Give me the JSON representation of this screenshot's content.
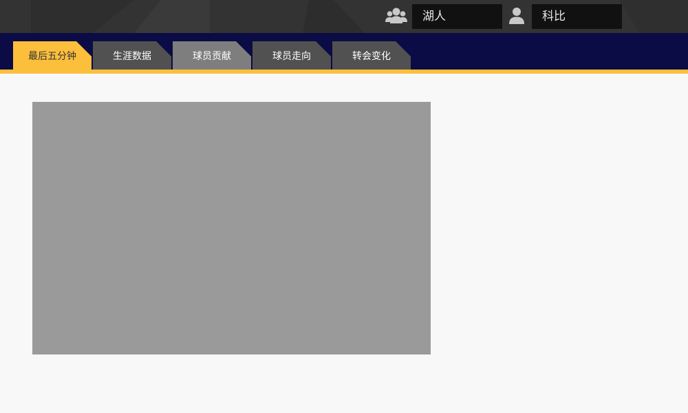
{
  "header": {
    "team_icon": "team-icon",
    "team_value": "湖人",
    "player_icon": "person-icon",
    "player_value": "科比"
  },
  "tabs": [
    {
      "label": "最后五分钟",
      "state": "active"
    },
    {
      "label": "生涯数据",
      "state": "normal"
    },
    {
      "label": "球员贡献",
      "state": "mid"
    },
    {
      "label": "球员走向",
      "state": "normal"
    },
    {
      "label": "转会变化",
      "state": "normal"
    }
  ],
  "colors": {
    "topbar": "#333333",
    "navband": "#0b0b45",
    "accent": "#fcbf3c",
    "tab_inactive": "#515151",
    "tab_mid": "#7e7e7e",
    "content_placeholder": "#9a9a9a",
    "page_bg": "#f8f8f8"
  }
}
